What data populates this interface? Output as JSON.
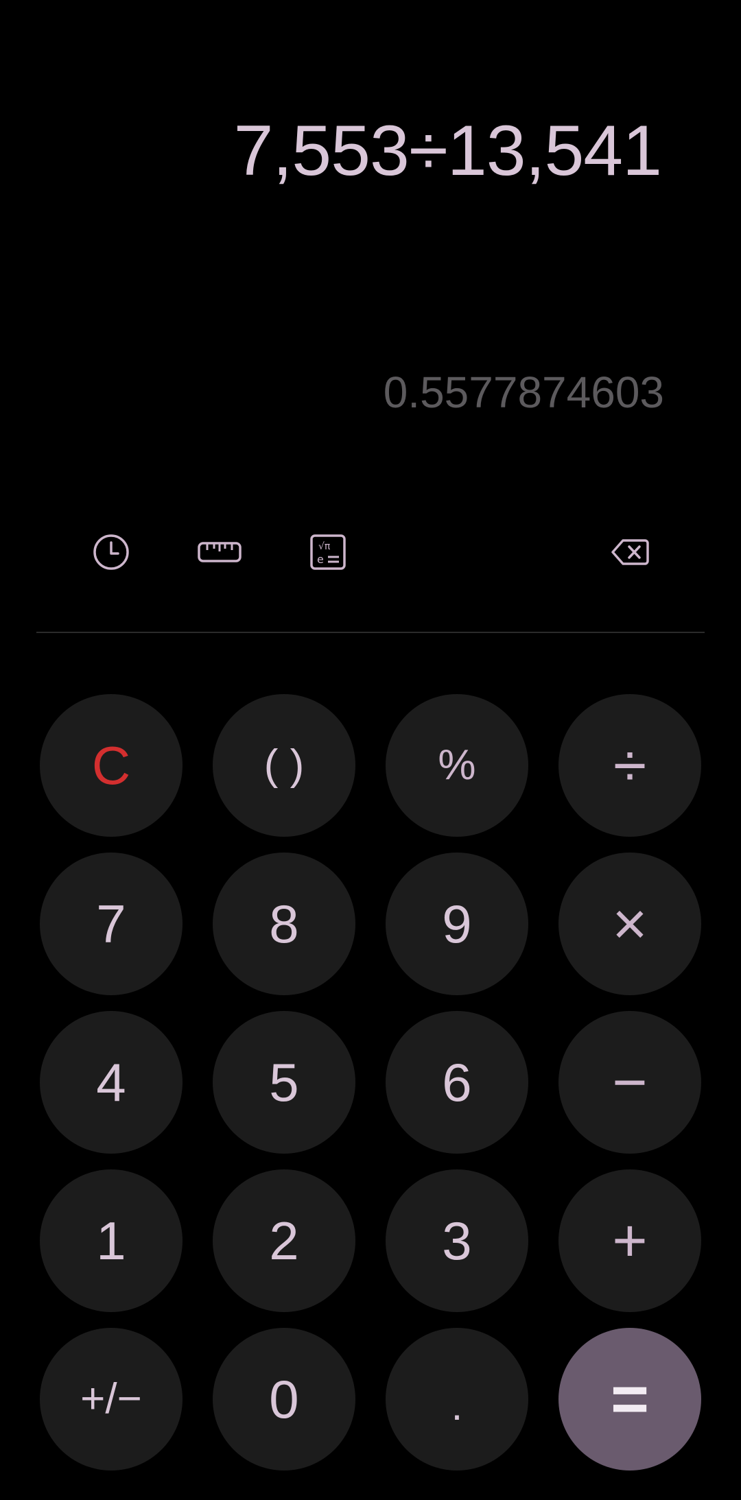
{
  "display": {
    "expression": "7,553÷13,541",
    "result": "0.5577874603"
  },
  "toolbar": {
    "icons": [
      "history-icon",
      "ruler-icon",
      "scientific-icon",
      "backspace-icon"
    ]
  },
  "keys": {
    "clear": "C",
    "parentheses": "( )",
    "percent": "%",
    "divide": "÷",
    "seven": "7",
    "eight": "8",
    "nine": "9",
    "multiply": "×",
    "four": "4",
    "five": "5",
    "six": "6",
    "minus": "−",
    "one": "1",
    "two": "2",
    "three": "3",
    "plus": "+",
    "sign": "+/−",
    "zero": "0",
    "decimal": ".",
    "equals": "="
  },
  "colors": {
    "background": "#000000",
    "key_background": "#1c1c1c",
    "text": "#d9c6d8",
    "result_text": "#5c5a5d",
    "clear_text": "#d32f2f",
    "equals_background": "#6a5b6e"
  }
}
